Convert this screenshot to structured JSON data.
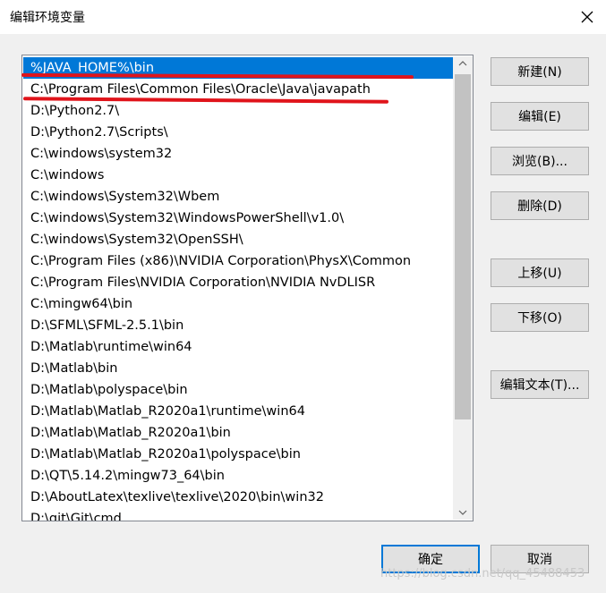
{
  "window": {
    "title": "编辑环境变量",
    "close_icon": "close-icon"
  },
  "path_list": {
    "items": [
      "%JAVA_HOME%\\bin",
      "C:\\Program Files\\Common Files\\Oracle\\Java\\javapath",
      "D:\\Python2.7\\",
      "D:\\Python2.7\\Scripts\\",
      "C:\\windows\\system32",
      "C:\\windows",
      "C:\\windows\\System32\\Wbem",
      "C:\\windows\\System32\\WindowsPowerShell\\v1.0\\",
      "C:\\windows\\System32\\OpenSSH\\",
      "C:\\Program Files (x86)\\NVIDIA Corporation\\PhysX\\Common",
      "C:\\Program Files\\NVIDIA Corporation\\NVIDIA NvDLISR",
      "C:\\mingw64\\bin",
      "D:\\SFML\\SFML-2.5.1\\bin",
      "D:\\Matlab\\runtime\\win64",
      "D:\\Matlab\\bin",
      "D:\\Matlab\\polyspace\\bin",
      "D:\\Matlab\\Matlab_R2020a1\\runtime\\win64",
      "D:\\Matlab\\Matlab_R2020a1\\bin",
      "D:\\Matlab\\Matlab_R2020a1\\polyspace\\bin",
      "D:\\QT\\5.14.2\\mingw73_64\\bin",
      "D:\\AboutLatex\\texlive\\texlive\\2020\\bin\\win32",
      "D:\\git\\Git\\cmd"
    ],
    "selected_index": 0,
    "selection_color": "#0078d7",
    "annotation_color": "#e0141b"
  },
  "buttons": {
    "new": "新建(N)",
    "edit": "编辑(E)",
    "browse": "浏览(B)...",
    "delete": "删除(D)",
    "move_up": "上移(U)",
    "move_down": "下移(O)",
    "edit_text": "编辑文本(T)...",
    "ok": "确定",
    "cancel": "取消"
  },
  "watermark": "https://blog.csdn.net/qq_45488453"
}
